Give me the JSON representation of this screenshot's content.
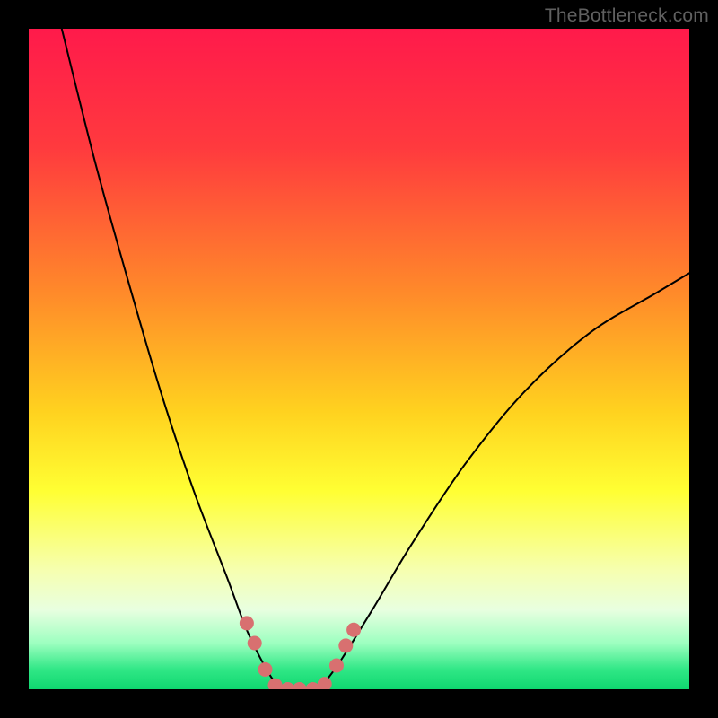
{
  "watermark": "TheBottleneck.com",
  "chart_data": {
    "type": "line",
    "title": "",
    "xlabel": "",
    "ylabel": "",
    "x_range": [
      0,
      100
    ],
    "y_range": [
      0,
      100
    ],
    "gradient_stops": [
      {
        "offset": 0,
        "color": "#ff1a4b"
      },
      {
        "offset": 18,
        "color": "#ff3a3e"
      },
      {
        "offset": 40,
        "color": "#ff8a2a"
      },
      {
        "offset": 58,
        "color": "#ffd21f"
      },
      {
        "offset": 70,
        "color": "#ffff33"
      },
      {
        "offset": 82,
        "color": "#f6ffb0"
      },
      {
        "offset": 88,
        "color": "#e8ffe0"
      },
      {
        "offset": 93,
        "color": "#9dffc0"
      },
      {
        "offset": 97,
        "color": "#30e786"
      },
      {
        "offset": 100,
        "color": "#0fd770"
      }
    ],
    "series": [
      {
        "name": "left-branch",
        "stroke": "#000000",
        "width": 2,
        "points": [
          {
            "x": 5,
            "y": 100
          },
          {
            "x": 10,
            "y": 80
          },
          {
            "x": 15,
            "y": 62
          },
          {
            "x": 20,
            "y": 45
          },
          {
            "x": 25,
            "y": 30
          },
          {
            "x": 30,
            "y": 17
          },
          {
            "x": 33,
            "y": 9
          },
          {
            "x": 36,
            "y": 3
          },
          {
            "x": 38,
            "y": 0
          }
        ]
      },
      {
        "name": "right-branch",
        "stroke": "#000000",
        "width": 2,
        "points": [
          {
            "x": 44,
            "y": 0
          },
          {
            "x": 47,
            "y": 4
          },
          {
            "x": 52,
            "y": 12
          },
          {
            "x": 58,
            "y": 22
          },
          {
            "x": 66,
            "y": 34
          },
          {
            "x": 75,
            "y": 45
          },
          {
            "x": 85,
            "y": 54
          },
          {
            "x": 95,
            "y": 60
          },
          {
            "x": 100,
            "y": 63
          }
        ]
      }
    ],
    "dots": {
      "color": "#d87070",
      "radius": 8,
      "points": [
        {
          "x": 33.0,
          "y": 10.0
        },
        {
          "x": 34.2,
          "y": 7.0
        },
        {
          "x": 35.8,
          "y": 3.0
        },
        {
          "x": 37.3,
          "y": 0.6
        },
        {
          "x": 39.2,
          "y": 0.0
        },
        {
          "x": 41.0,
          "y": 0.0
        },
        {
          "x": 43.0,
          "y": 0.0
        },
        {
          "x": 44.8,
          "y": 0.8
        },
        {
          "x": 46.6,
          "y": 3.6
        },
        {
          "x": 48.0,
          "y": 6.6
        },
        {
          "x": 49.2,
          "y": 9.0
        }
      ]
    }
  }
}
